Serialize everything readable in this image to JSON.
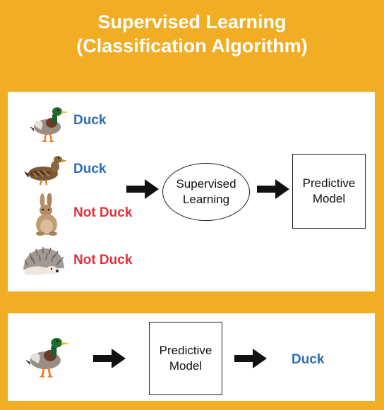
{
  "title": {
    "line1": "Supervised Learning",
    "line2": "(Classification Algorithm)"
  },
  "training": {
    "examples": [
      {
        "animal": "duck-mallard-icon",
        "label": "Duck"
      },
      {
        "animal": "duck-female-icon",
        "label": "Duck"
      },
      {
        "animal": "rabbit-icon",
        "label": "Not Duck"
      },
      {
        "animal": "hedgehog-icon",
        "label": "Not Duck"
      }
    ],
    "process_label": "Supervised\nLearning",
    "model_label": "Predictive\nModel"
  },
  "prediction": {
    "input": "duck-mallard-icon",
    "model_label": "Predictive\nModel",
    "output_label": "Duck"
  },
  "colors": {
    "background": "#f1ad23",
    "duck_label": "#2a6db5",
    "not_duck_label": "#e2303a"
  }
}
